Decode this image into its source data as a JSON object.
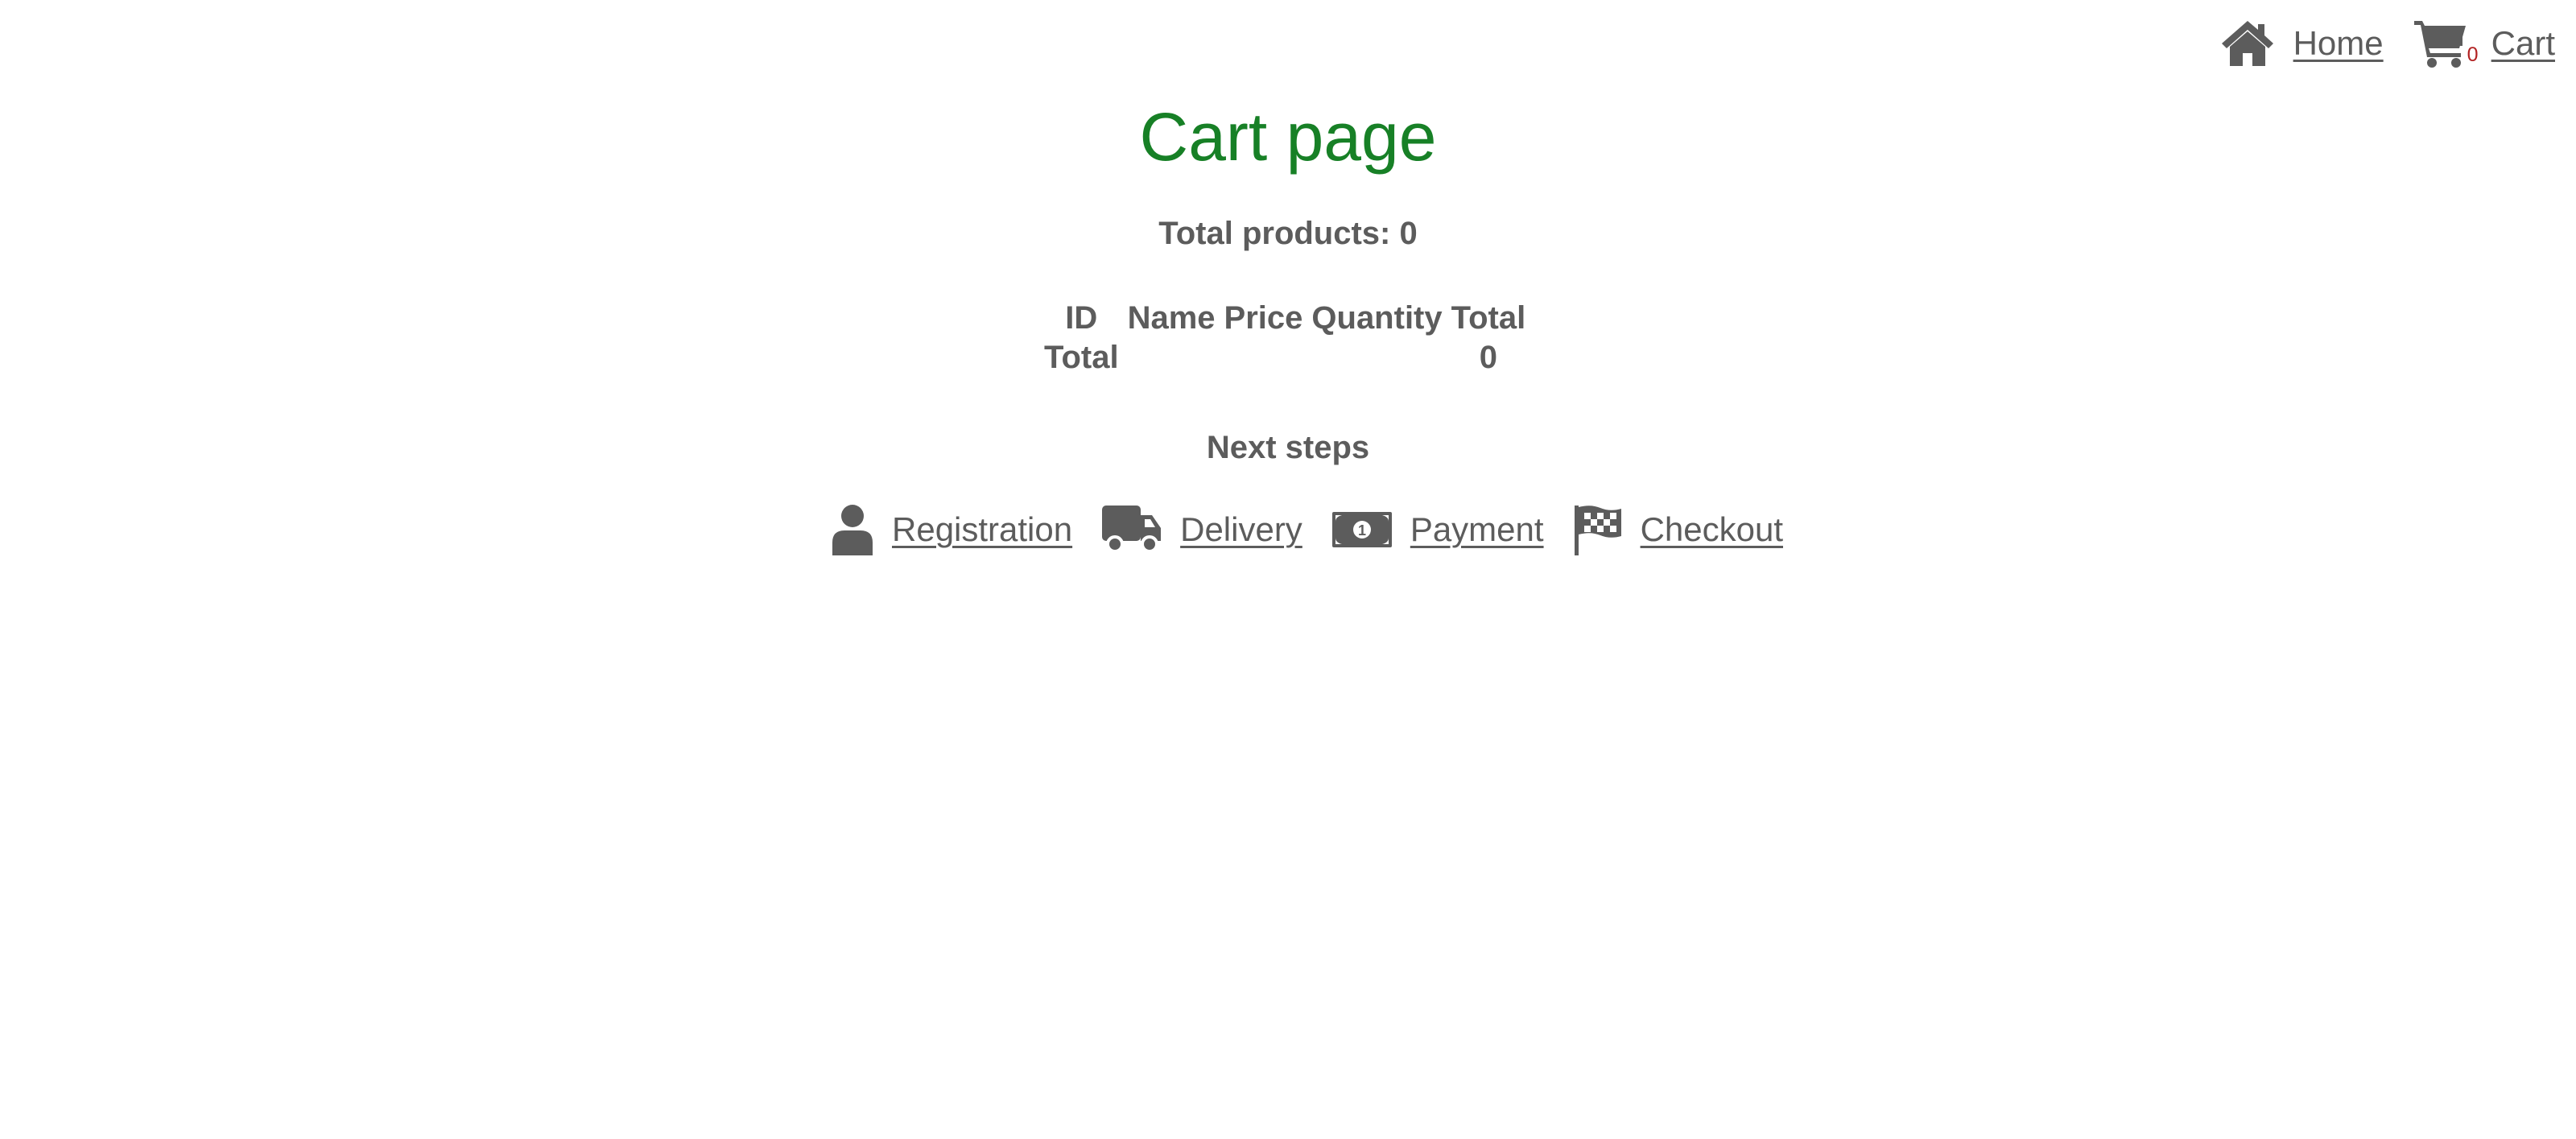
{
  "nav": {
    "home_label": "Home",
    "cart_label": "Cart",
    "cart_count": "0",
    "home_icon": "home-icon",
    "cart_icon": "shopping-cart-icon"
  },
  "page": {
    "title": "Cart page",
    "title_color": "#178026",
    "total_products_label": "Total products: 0"
  },
  "table": {
    "headers": [
      "ID",
      "Name",
      "Price",
      "Quantity",
      "Total"
    ],
    "footer": {
      "label": "Total",
      "total_value": "0"
    }
  },
  "next_steps": {
    "title": "Next steps",
    "items": [
      {
        "label": "Registration",
        "icon": "user-icon"
      },
      {
        "label": "Delivery",
        "icon": "truck-icon"
      },
      {
        "label": "Payment",
        "icon": "money-bill-icon"
      },
      {
        "label": "Checkout",
        "icon": "checkered-flag-icon"
      }
    ]
  },
  "colors": {
    "text": "#5c5c5c",
    "cart_badge": "#b22222",
    "background": "#ffffff"
  }
}
